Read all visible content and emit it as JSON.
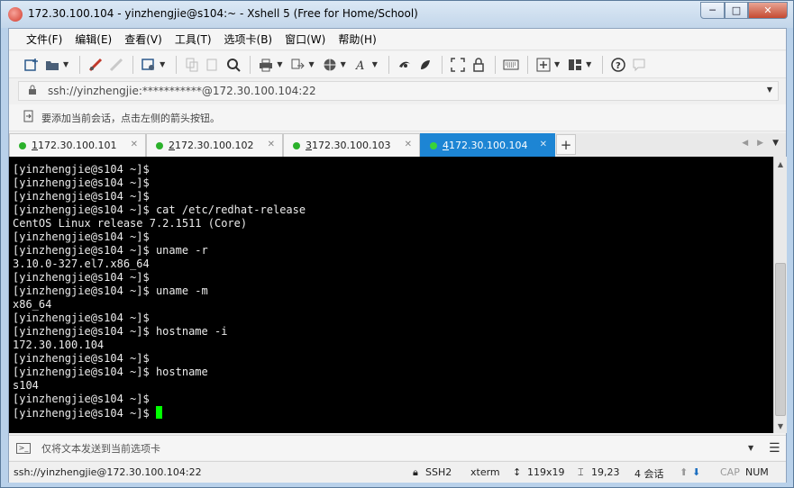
{
  "window": {
    "title": "172.30.100.104 - yinzhengjie@s104:~ - Xshell 5 (Free for Home/School)",
    "minimize": "─",
    "maximize": "□",
    "close": "✕"
  },
  "menu": {
    "items": [
      "文件(F)",
      "编辑(E)",
      "查看(V)",
      "工具(T)",
      "选项卡(B)",
      "窗口(W)",
      "帮助(H)"
    ]
  },
  "toolbar": {
    "icons": [
      "new-session-icon",
      "open-folder-icon",
      "connect-icon",
      "disconnect-icon",
      "properties-icon",
      "copy-icon",
      "paste-icon",
      "find-icon",
      "print-icon",
      "transfer-icon",
      "globe-icon",
      "font-icon",
      "xftp-icon",
      "xmanager-icon",
      "fullscreen-icon",
      "lock-icon",
      "keyboard-icon",
      "add-tab-icon",
      "layout-icon",
      "help-icon",
      "comment-icon"
    ]
  },
  "address": {
    "value": "ssh://yinzhengjie:***********@172.30.100.104:22"
  },
  "hint": {
    "text": "要添加当前会话，点击左侧的箭头按钮。"
  },
  "tabs": [
    {
      "num": "1",
      "label": " 172.30.100.101",
      "active": false
    },
    {
      "num": "2",
      "label": " 172.30.100.102",
      "active": false
    },
    {
      "num": "3",
      "label": " 172.30.100.103",
      "active": false
    },
    {
      "num": "4",
      "label": " 172.30.100.104",
      "active": true
    }
  ],
  "tab_add": "+",
  "terminal": {
    "lines": [
      "[yinzhengjie@s104 ~]$",
      "[yinzhengjie@s104 ~]$",
      "[yinzhengjie@s104 ~]$",
      "[yinzhengjie@s104 ~]$ cat /etc/redhat-release",
      "CentOS Linux release 7.2.1511 (Core)",
      "[yinzhengjie@s104 ~]$",
      "[yinzhengjie@s104 ~]$ uname -r",
      "3.10.0-327.el7.x86_64",
      "[yinzhengjie@s104 ~]$",
      "[yinzhengjie@s104 ~]$ uname -m",
      "x86_64",
      "[yinzhengjie@s104 ~]$",
      "[yinzhengjie@s104 ~]$ hostname -i",
      "172.30.100.104",
      "[yinzhengjie@s104 ~]$",
      "[yinzhengjie@s104 ~]$ hostname",
      "s104",
      "[yinzhengjie@s104 ~]$",
      "[yinzhengjie@s104 ~]$ "
    ],
    "background": "#000000",
    "foreground": "#ececec",
    "cursor_color": "#00ff00"
  },
  "compose": {
    "text": "仅将文本发送到当前选项卡"
  },
  "status": {
    "connection": "ssh://yinzhengjie@172.30.100.104:22",
    "protocol": "SSH2",
    "terminal_type": "xterm",
    "size": "119x19",
    "position": "19,23",
    "sessions": "4 会话",
    "caps": "CAP",
    "num": "NUM"
  },
  "colors": {
    "active_tab": "#1d85d4",
    "connected_dot": "#2bb12b"
  }
}
